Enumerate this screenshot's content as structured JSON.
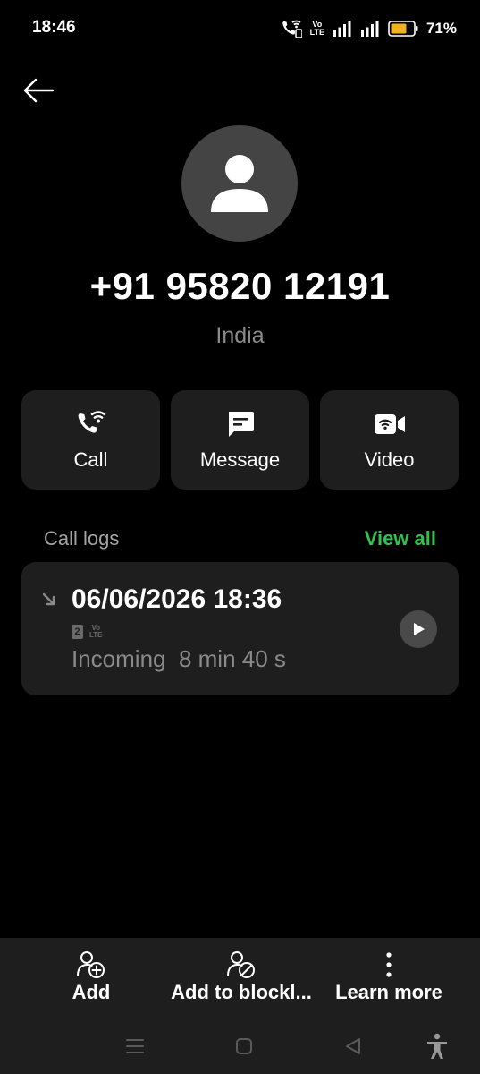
{
  "status_bar": {
    "time": "18:46",
    "volte_top": "Vo",
    "volte_bottom": "LTE",
    "battery_percent": "71%",
    "battery_level": 0.71,
    "battery_color": "#f2b01e"
  },
  "contact": {
    "phone_number": "+91 95820 12191",
    "country": "India"
  },
  "actions": [
    {
      "label": "Call",
      "icon": "wifi-call-icon"
    },
    {
      "label": "Message",
      "icon": "message-icon"
    },
    {
      "label": "Video",
      "icon": "video-call-icon"
    }
  ],
  "call_logs": {
    "title": "Call logs",
    "view_all": "View all",
    "accent_color": "#2fc24f",
    "entries": [
      {
        "date_time": "06/06/2026 18:36",
        "sim": "2",
        "volte_top": "Vo",
        "volte_bottom": "LTE",
        "detail": "Incoming  8 min 40 s",
        "direction_icon": "incoming-arrow-icon"
      }
    ]
  },
  "bottom_bar": {
    "add_label": "Add",
    "blocklist_label": "Add to blockl...",
    "learn_more_label": "Learn more"
  }
}
